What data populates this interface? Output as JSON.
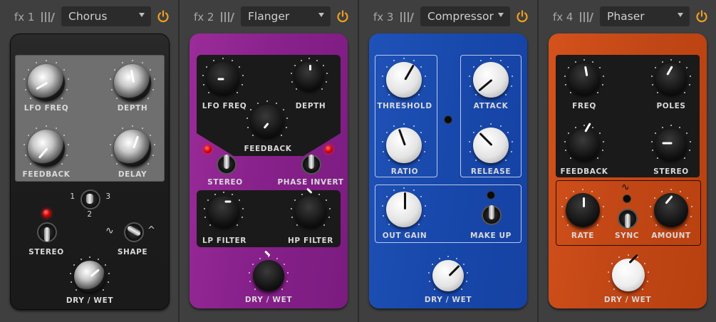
{
  "slots": [
    {
      "fx_label": "fx 1",
      "effect": "Chorus",
      "power_color": "#f0a020",
      "knobs": {
        "lfo_freq": "LFO FREQ",
        "depth": "DEPTH",
        "feedback": "FEEDBACK",
        "delay": "DELAY",
        "dry_wet": "DRY / WET"
      },
      "switches": {
        "stereo": "STEREO",
        "shape": "SHAPE",
        "mode_1": "1",
        "mode_2": "2",
        "mode_3": "3"
      }
    },
    {
      "fx_label": "fx 2",
      "effect": "Flanger",
      "power_color": "#f0a020",
      "knobs": {
        "lfo_freq": "LFO FREQ",
        "depth": "DEPTH",
        "feedback": "FEEDBACK",
        "lp_filter": "LP FILTER",
        "hp_filter": "HP FILTER",
        "dry_wet": "DRY / WET"
      },
      "switches": {
        "stereo": "STEREO",
        "phase_invert": "PHASE INVERT"
      }
    },
    {
      "fx_label": "fx 3",
      "effect": "Compressor",
      "power_color": "#f0a020",
      "knobs": {
        "threshold": "THRESHOLD",
        "attack": "ATTACK",
        "ratio": "RATIO",
        "release": "RELEASE",
        "out_gain": "OUT GAIN",
        "dry_wet": "DRY / WET"
      },
      "switches": {
        "make_up": "MAKE UP"
      }
    },
    {
      "fx_label": "fx 4",
      "effect": "Phaser",
      "power_color": "#f0a020",
      "knobs": {
        "freq": "FREQ",
        "poles": "POLES",
        "feedback": "FEEDBACK",
        "stereo": "STEREO",
        "rate": "RATE",
        "amount": "AMOUNT",
        "dry_wet": "DRY / WET"
      },
      "switches": {
        "sync": "SYNC"
      }
    }
  ]
}
